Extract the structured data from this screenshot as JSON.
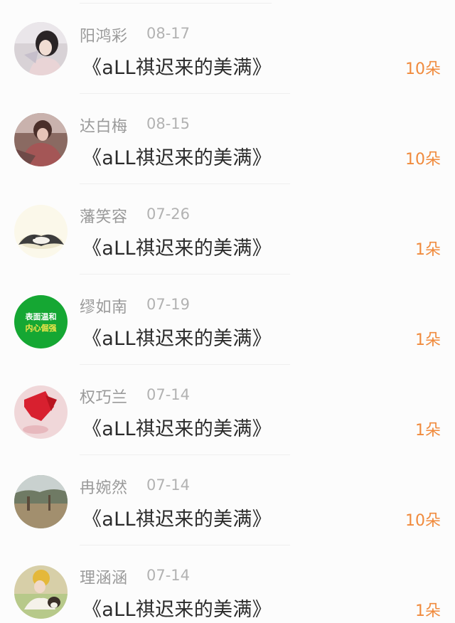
{
  "items": [
    {
      "name": "阳鸿彩",
      "date": "08-17",
      "title": "《aLL祺迟来的美满》",
      "count": "10朵",
      "avatar": "user-photo-girl-avatar"
    },
    {
      "name": "达白梅",
      "date": "08-15",
      "title": "《aLL祺迟来的美满》",
      "count": "10朵",
      "avatar": "user-photo-avatar"
    },
    {
      "name": "藩笑容",
      "date": "07-26",
      "title": "《aLL祺迟来的美满》",
      "count": "1朵",
      "avatar": "cartoon-animal-avatar"
    },
    {
      "name": "缪如南",
      "date": "07-19",
      "title": "《aLL祺迟来的美满》",
      "count": "1朵",
      "avatar": "green-text-avatar",
      "avatar_text_line1": "表面温和",
      "avatar_text_line2": "内心倔强"
    },
    {
      "name": "权巧兰",
      "date": "07-14",
      "title": "《aLL祺迟来的美满》",
      "count": "1朵",
      "avatar": "red-pink-avatar"
    },
    {
      "name": "冉婉然",
      "date": "07-14",
      "title": "《aLL祺迟来的美满》",
      "count": "10朵",
      "avatar": "landscape-avatar"
    },
    {
      "name": "理涵涵",
      "date": "07-14",
      "title": "《aLL祺迟来的美满》",
      "count": "1朵",
      "avatar": "dog-photo-avatar"
    }
  ],
  "colors": {
    "count": "#f08a3c",
    "name": "#9a9a9a",
    "title": "#2b2b2b"
  }
}
